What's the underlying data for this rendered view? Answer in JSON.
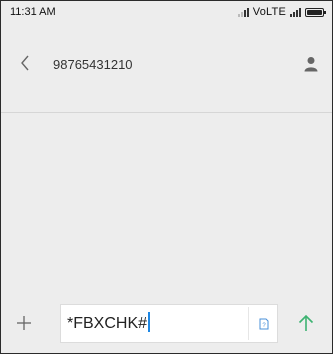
{
  "status_bar": {
    "time": "11:31 AM",
    "network": "VoLTE"
  },
  "header": {
    "contact": "98765431210",
    "back_icon": "chevron-left-icon",
    "contact_icon": "person-icon"
  },
  "compose": {
    "message_text": "*FBXCHK#",
    "attach_icon": "plus-icon",
    "sim_icon": "sim-card-icon",
    "send_icon": "arrow-up-icon"
  },
  "colors": {
    "background": "#ededed",
    "send_accent": "#3cb371",
    "caret": "#1e88e5",
    "sim_icon": "#4a90d9"
  }
}
